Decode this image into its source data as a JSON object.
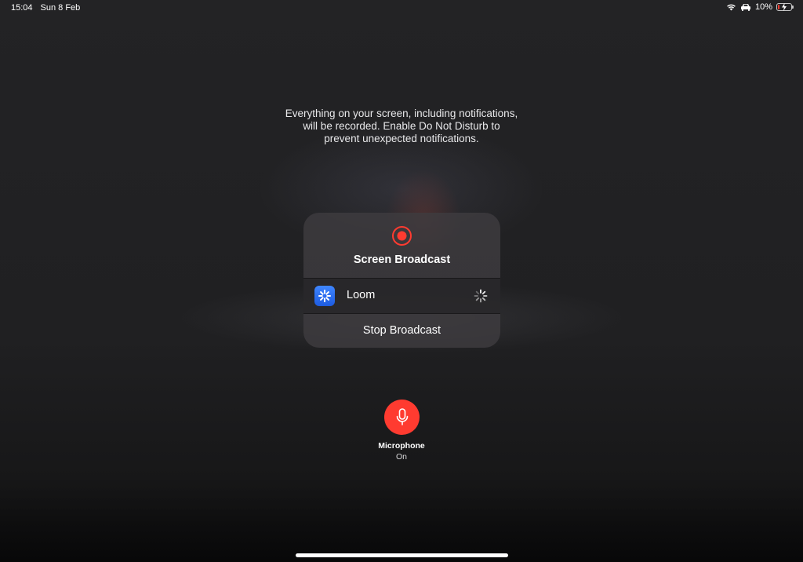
{
  "status_bar": {
    "time": "15:04",
    "date": "Sun 8 Feb",
    "battery_percent": "10%",
    "battery_level": 0.1,
    "icons": [
      "wifi-icon",
      "car-icon",
      "battery-charging-icon"
    ]
  },
  "warning_text": "Everything on your screen, including notifications, will be recorded. Enable Do Not Disturb to prevent unexpected notifications.",
  "broadcast": {
    "title": "Screen Broadcast",
    "record_icon": "record-icon",
    "app_name": "Loom",
    "app_icon": "loom-app-icon",
    "loading_icon": "spinner-icon",
    "stop_label": "Stop Broadcast"
  },
  "microphone": {
    "label": "Microphone",
    "status": "On",
    "icon": "microphone-icon",
    "color": "#ff3b30"
  },
  "colors": {
    "record_red": "#ff3b30",
    "loom_blue": "#2f6ff0"
  }
}
